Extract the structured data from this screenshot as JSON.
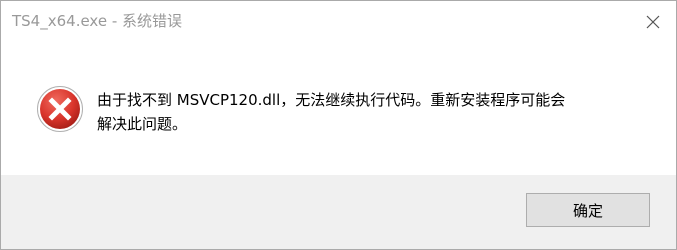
{
  "window": {
    "title": "TS4_x64.exe - 系统错误"
  },
  "dialog": {
    "message_line1": "由于找不到 MSVCP120.dll，无法继续执行代码。重新安装程序可能会",
    "message_line2": "解决此问题。",
    "icon": "error-icon",
    "ok_label": "确定"
  },
  "colors": {
    "footer_bg": "#f0f0f0",
    "error_red": "#d9342b"
  }
}
